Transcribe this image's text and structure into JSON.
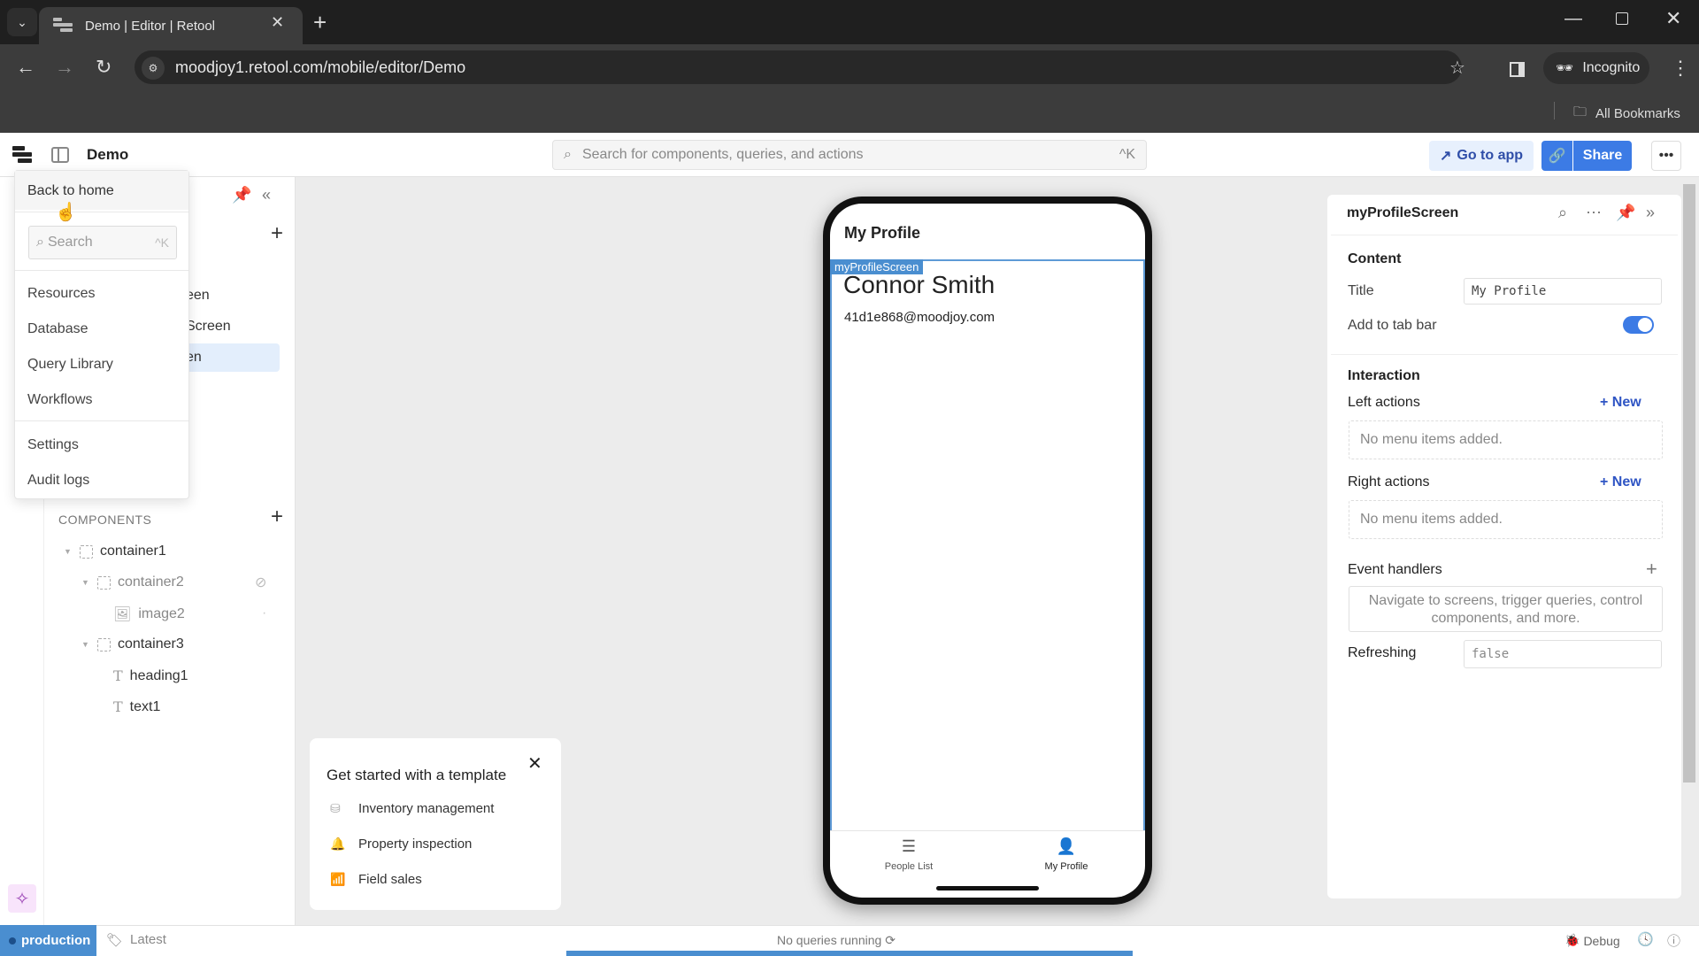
{
  "browser": {
    "tab_title": "Demo | Editor | Retool",
    "url": "moodjoy1.retool.com/mobile/editor/Demo",
    "profile_label": "Incognito",
    "bookmarks_label": "All Bookmarks"
  },
  "header": {
    "app_name": "Demo",
    "search_placeholder": "Search for components, queries, and actions",
    "search_shortcut": "^K",
    "go_to_app_label": "Go to app",
    "share_label": "Share"
  },
  "menu": {
    "back_label": "Back to home",
    "search_placeholder": "Search",
    "search_shortcut": "^K",
    "items": [
      "Resources",
      "Database",
      "Query Library",
      "Workflows"
    ],
    "items2": [
      "Settings",
      "Audit logs"
    ]
  },
  "screens": {
    "partial_items": [
      "een",
      "Screen",
      "en"
    ]
  },
  "components": {
    "header": "COMPONENTS",
    "tree": [
      {
        "label": "container1",
        "type": "container",
        "depth": 0
      },
      {
        "label": "container2",
        "type": "container",
        "depth": 1,
        "hidden": true
      },
      {
        "label": "image2",
        "type": "image",
        "depth": 2
      },
      {
        "label": "container3",
        "type": "container",
        "depth": 1
      },
      {
        "label": "heading1",
        "type": "text",
        "depth": 2
      },
      {
        "label": "text1",
        "type": "text",
        "depth": 2
      }
    ]
  },
  "phone": {
    "screen_title": "My Profile",
    "selection_label": "myProfileScreen",
    "name": "Connor Smith",
    "email": "41d1e868@moodjoy.com",
    "tabs": [
      {
        "label": "People List",
        "icon": "list-icon"
      },
      {
        "label": "My Profile",
        "icon": "person-icon"
      }
    ]
  },
  "template_card": {
    "title": "Get started with a template",
    "items": [
      "Inventory management",
      "Property inspection",
      "Field sales"
    ]
  },
  "inspector": {
    "title": "myProfileScreen",
    "content_header": "Content",
    "title_label": "Title",
    "title_value": "My Profile",
    "tab_bar_label": "Add to tab bar",
    "tab_bar_enabled": true,
    "interaction_header": "Interaction",
    "left_actions_label": "Left actions",
    "right_actions_label": "Right actions",
    "new_label": "New",
    "empty_menu_text": "No menu items added.",
    "event_handlers_label": "Event handlers",
    "event_handlers_hint": "Navigate to screens, trigger queries, control components, and more.",
    "refreshing_label": "Refreshing",
    "refreshing_value": "false"
  },
  "statusbar": {
    "environment": "production",
    "release": "Latest",
    "queries_status": "No queries running",
    "debug_label": "Debug"
  },
  "colors": {
    "accent": "#3c7be5",
    "environment": "#4a8ed0",
    "selection": "#5e9ad6"
  }
}
